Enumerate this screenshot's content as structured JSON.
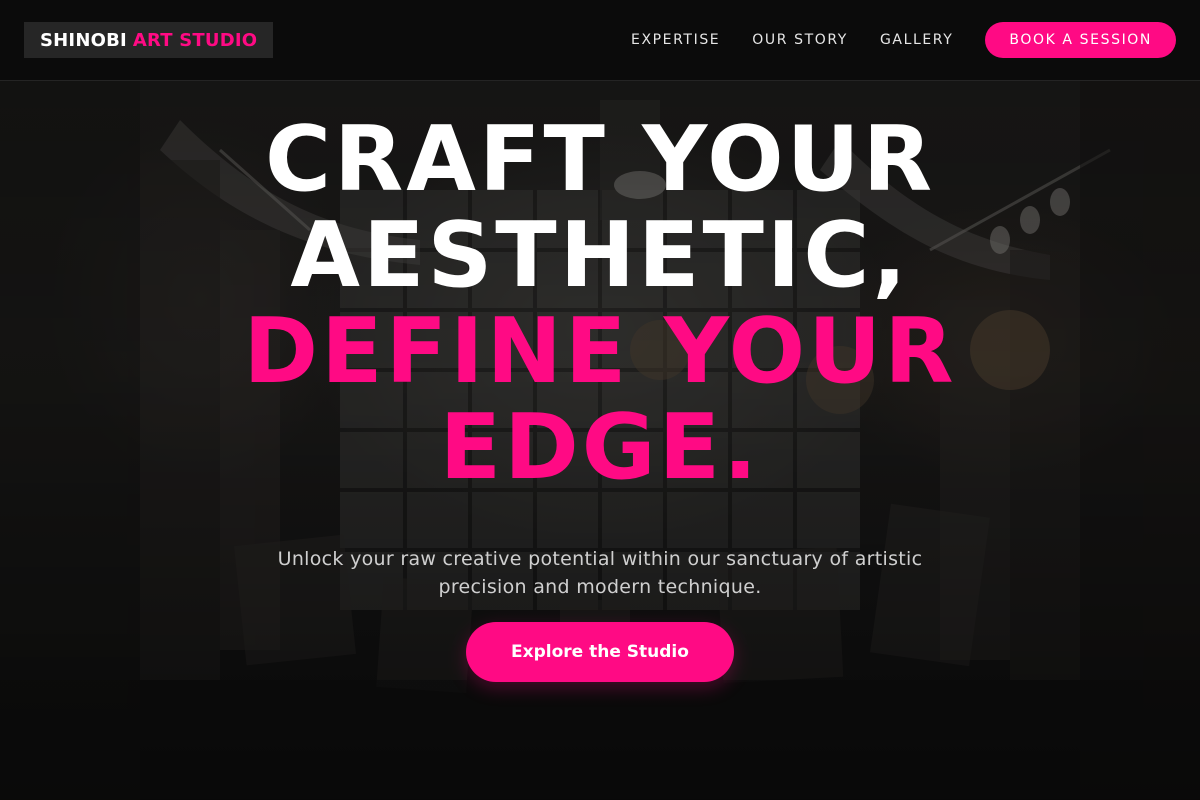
{
  "header": {
    "logo": {
      "primary": "SHINOBI",
      "accent": "ART STUDIO"
    },
    "nav": [
      {
        "label": "EXPERTISE"
      },
      {
        "label": "OUR STORY"
      },
      {
        "label": "GALLERY"
      }
    ],
    "cta_label": "BOOK A SESSION"
  },
  "hero": {
    "headline": {
      "line1": "CRAFT YOUR",
      "line2": "AESTHETIC,",
      "line3": "DEFINE YOUR",
      "line4": "EDGE."
    },
    "subtitle": "Unlock your raw creative potential within our sanctuary of artistic precision and modern technique.",
    "cta_label": "Explore the Studio"
  },
  "colors": {
    "accent": "#ff0a84",
    "background": "#0b0b0b",
    "text_primary": "#ffffff",
    "text_secondary": "#cfcfcf"
  }
}
